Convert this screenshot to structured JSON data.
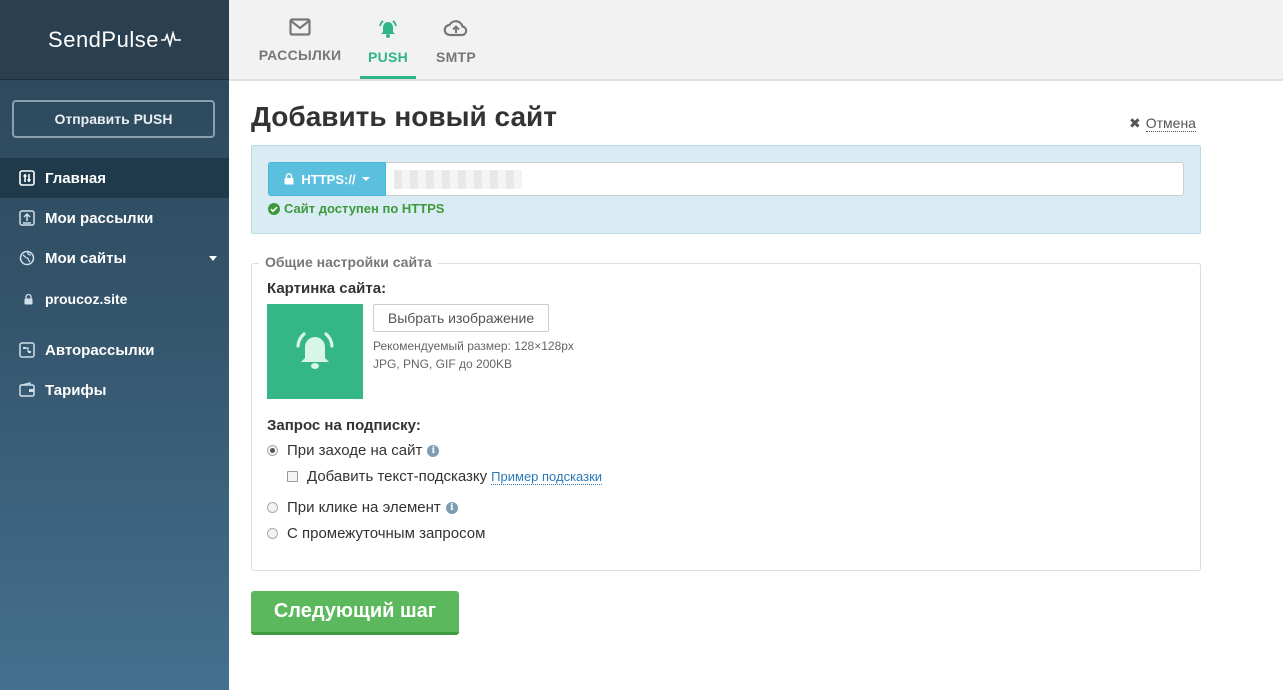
{
  "app": {
    "logo": "SendPulse"
  },
  "sidebar": {
    "send_button": "Отправить PUSH",
    "items": [
      {
        "label": "Главная",
        "icon": "sliders-icon"
      },
      {
        "label": "Мои рассылки",
        "icon": "upload-box-icon"
      },
      {
        "label": "Мои сайты",
        "icon": "globe-icon"
      },
      {
        "label": "proucoz.site",
        "icon": "lock-icon"
      },
      {
        "label": "Авторассылки",
        "icon": "flow-icon"
      },
      {
        "label": "Тарифы",
        "icon": "wallet-icon"
      }
    ]
  },
  "tabs": [
    {
      "label": "РАССЫЛКИ",
      "icon": "envelope-icon"
    },
    {
      "label": "PUSH",
      "icon": "bell-icon",
      "active": true
    },
    {
      "label": "SMTP",
      "icon": "cloud-upload-icon"
    }
  ],
  "main": {
    "title": "Добавить новый сайт",
    "cancel": "Отмена",
    "protocol": "HTTPS://",
    "url_value": "",
    "https_status": "Сайт доступен по HTTPS",
    "section_title": "Общие настройки сайта",
    "image_label": "Картинка сайта:",
    "choose_image": "Выбрать изображение",
    "recommended_size": "Рекомендуемый размер: 128×128px",
    "formats": "JPG, PNG, GIF до 200KB",
    "subscription_label": "Запрос на подписку:",
    "options": [
      {
        "label": "При заходе на сайт",
        "selected": true
      },
      {
        "label": "При клике на элемент",
        "selected": false
      },
      {
        "label": "С промежуточным запросом",
        "selected": false
      }
    ],
    "hint_checkbox": "Добавить текст-подсказку",
    "hint_example": "Пример подсказки",
    "next_button": "Следующий шаг"
  },
  "colors": {
    "accent": "#2fb587",
    "sidebar_dark": "#2a3f4f",
    "https_bg": "#d9ecf4",
    "button_green": "#5cb85c",
    "proto_blue": "#5bc0de"
  }
}
